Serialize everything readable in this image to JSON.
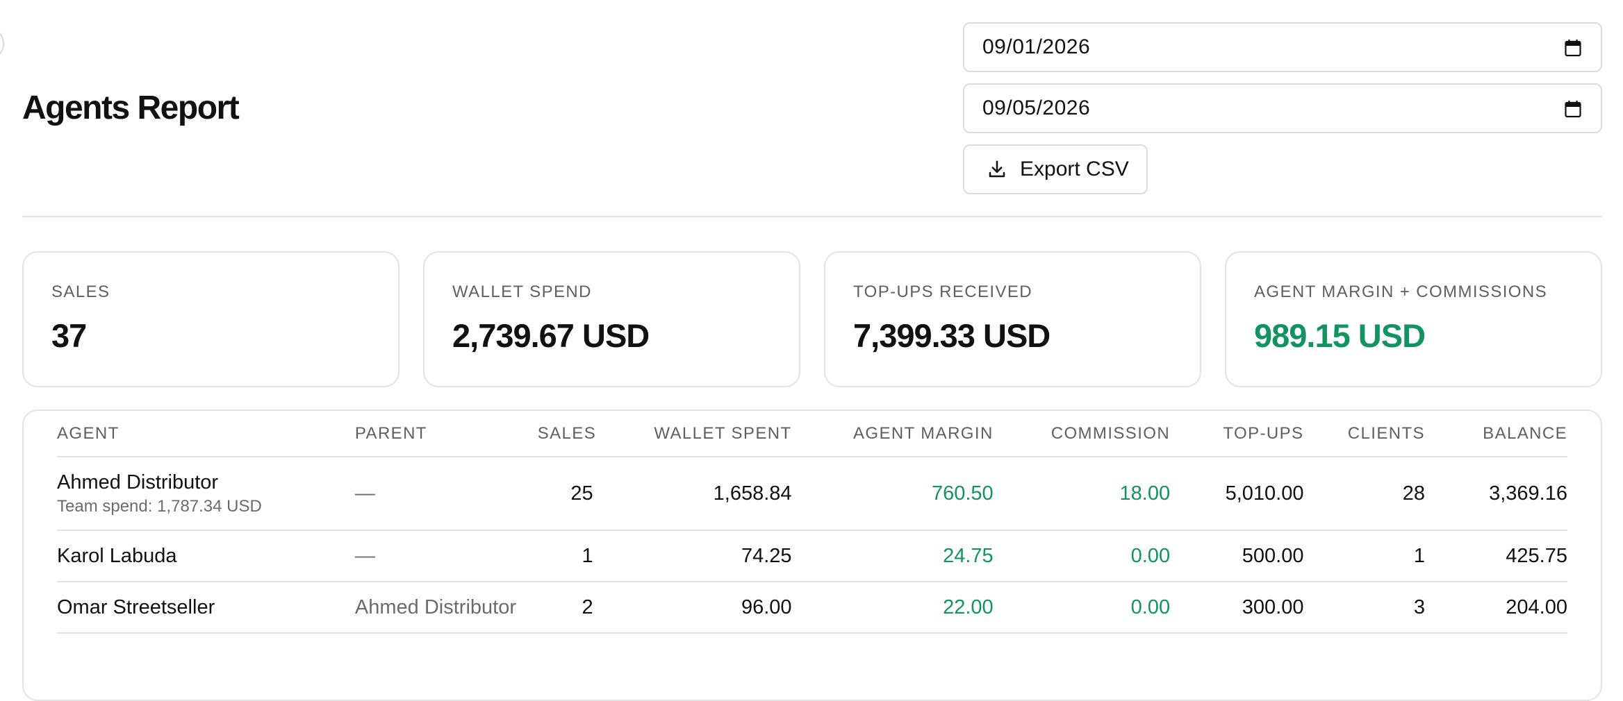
{
  "page": {
    "title": "Agents Report"
  },
  "filters": {
    "date_from": "09/01/2026",
    "date_to": "09/05/2026",
    "export_label": "Export CSV",
    "export_icon": "download-icon",
    "date_icon": "calendar-icon"
  },
  "stats": [
    {
      "label": "SALES",
      "value": "37",
      "color": "#111111"
    },
    {
      "label": "WALLET SPEND",
      "value": "2,739.67 USD",
      "color": "#111111"
    },
    {
      "label": "TOP-UPS RECEIVED",
      "value": "7,399.33 USD",
      "color": "#111111"
    },
    {
      "label": "AGENT MARGIN + COMMISSIONS",
      "value": "989.15 USD",
      "color": "#12935f"
    }
  ],
  "table": {
    "columns": [
      "AGENT",
      "PARENT",
      "SALES",
      "WALLET SPENT",
      "AGENT MARGIN",
      "COMMISSION",
      "TOP-UPS",
      "CLIENTS",
      "BALANCE"
    ],
    "rows": [
      {
        "agent": "Ahmed Distributor",
        "agent_sub": "Team spend: 1,787.34 USD",
        "parent": "—",
        "sales": "25",
        "wallet_spent": "1,658.84",
        "agent_margin": "760.50",
        "commission": "18.00",
        "top_ups": "5,010.00",
        "clients": "28",
        "balance": "3,369.16"
      },
      {
        "agent": "Karol Labuda",
        "parent": "—",
        "sales": "1",
        "wallet_spent": "74.25",
        "agent_margin": "24.75",
        "commission": "0.00",
        "top_ups": "500.00",
        "clients": "1",
        "balance": "425.75"
      },
      {
        "agent": "Omar Streetseller",
        "parent": "Ahmed Distributor",
        "sales": "2",
        "wallet_spent": "96.00",
        "agent_margin": "22.00",
        "commission": "0.00",
        "top_ups": "300.00",
        "clients": "3",
        "balance": "204.00"
      }
    ]
  },
  "colors": {
    "accent_green": "#12935f",
    "border": "#e3e3e3",
    "muted_text": "#5f5f5f"
  }
}
